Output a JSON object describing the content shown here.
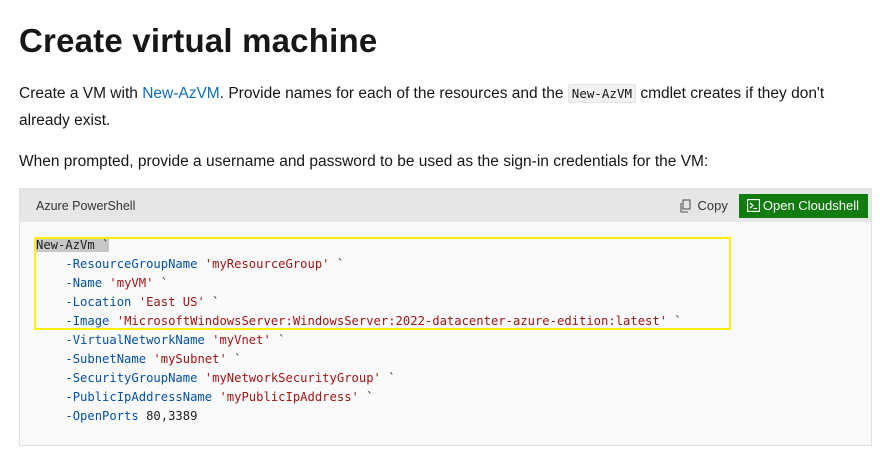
{
  "heading": "Create virtual machine",
  "intro": {
    "before": "Create a VM with ",
    "link": "New-AzVM",
    "middle": ". Provide names for each of the resources and the ",
    "code": "New-AzVM",
    "after": " cmdlet creates if they don't already exist."
  },
  "prompt_text": "When prompted, provide a username and password to be used as the sign-in credentials for the VM:",
  "code_block": {
    "language": "Azure PowerShell",
    "copy_label": "Copy",
    "cloudshell_label": "Open Cloudshell",
    "first_line": {
      "cmd": "New-AzVm",
      "tail": " `"
    },
    "lines": [
      {
        "param": "-ResourceGroupName",
        "value": "'myResourceGroup'",
        "tail": " `"
      },
      {
        "param": "-Name",
        "value": "'myVM'",
        "tail": " `"
      },
      {
        "param": "-Location",
        "value": "'East US'",
        "tail": " `"
      },
      {
        "param": "-Image",
        "value": "'MicrosoftWindowsServer:WindowsServer:2022-datacenter-azure-edition:latest'",
        "tail": " `"
      },
      {
        "param": "-VirtualNetworkName",
        "value": "'myVnet'",
        "tail": " `"
      },
      {
        "param": "-SubnetName",
        "value": "'mySubnet'",
        "tail": " `"
      },
      {
        "param": "-SecurityGroupName",
        "value": "'myNetworkSecurityGroup'",
        "tail": " `"
      },
      {
        "param": "-PublicIpAddressName",
        "value": "'myPublicIpAddress'",
        "tail": " `"
      },
      {
        "param": "-OpenPorts",
        "value": "80,3389",
        "tail": ""
      }
    ]
  },
  "icons": {
    "copy": "copy-icon",
    "cloudshell": "cloudshell-icon"
  },
  "colors": {
    "link": "#0f6cbd",
    "cloudshell_button": "#107c10",
    "highlight_box": "#ffef00",
    "string": "#a31515",
    "param": "#0451a5"
  }
}
